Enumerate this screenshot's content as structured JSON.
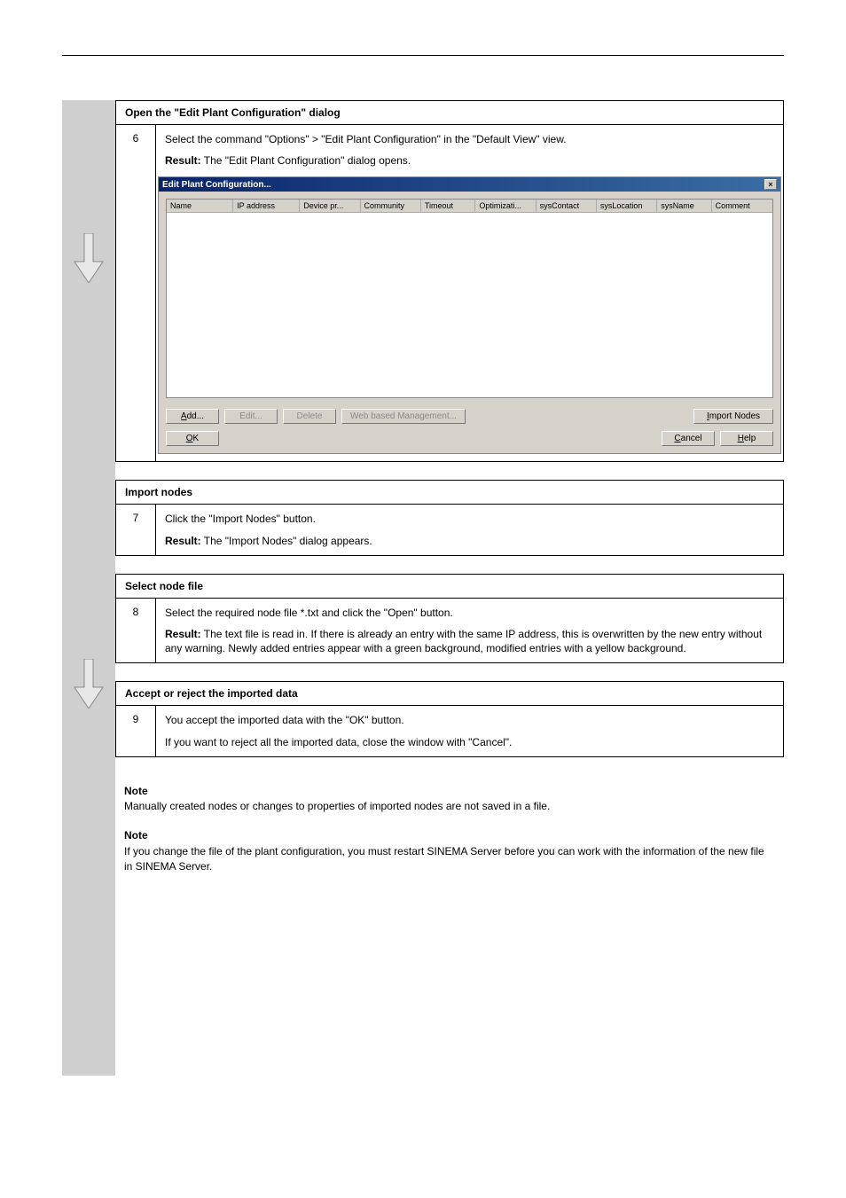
{
  "header": {
    "chapterLine": "",
    "sectionLine": ""
  },
  "sidebar": {
    "arrow1_alt": "down-arrow",
    "arrow2_alt": "down-arrow"
  },
  "step6": {
    "num": "6",
    "title": "Open the \"Edit Plant Configuration\" dialog",
    "para1": "Select the command \"Options\" > \"Edit Plant Configuration\" in the \"Default View\" view.",
    "resultLabel": "Result:",
    "resultText": " The \"Edit Plant Configuration\" dialog opens."
  },
  "dialog": {
    "title": "Edit Plant Configuration...",
    "columns": [
      "Name",
      "IP address",
      "Device pr...",
      "Community",
      "Timeout",
      "Optimizati...",
      "sysContact",
      "sysLocation",
      "sysName",
      "Comment"
    ],
    "buttons": {
      "add": "Add...",
      "edit": "Edit...",
      "delete": "Delete",
      "wbm": "Web based Management...",
      "import": "Import Nodes",
      "ok": "OK",
      "cancel": "Cancel",
      "help": "Help"
    },
    "close": "×"
  },
  "step7": {
    "num": "7",
    "title": "Import nodes",
    "para1": "Click the \"Import Nodes\" button.",
    "resultLabel": "Result:",
    "resultText": " The \"Import Nodes\" dialog appears."
  },
  "step8": {
    "num": "8",
    "title": "Select node file",
    "para1": "Select the required node file *.txt and click the \"Open\" button.",
    "resultLabel": "Result:",
    "resultText": " The text file is read in. If there is already an entry with the same IP address, this is overwritten by the new entry without any warning. Newly added entries appear with a green background, modified entries with a yellow background."
  },
  "step9": {
    "num": "9",
    "title": "Accept or reject the imported data",
    "para1": "You accept the imported data with the \"OK\" button.",
    "para2": "If you want to reject all the imported data, close the window with \"Cancel\"."
  },
  "notes": {
    "n1": {
      "title": "Note",
      "body": "Manually created nodes or changes to properties of imported nodes are not saved in a file."
    },
    "n2": {
      "title": "Note",
      "body": "If you change the file of the plant configuration, you must restart SINEMA Server before you can work with the information of the new file in SINEMA Server."
    }
  }
}
